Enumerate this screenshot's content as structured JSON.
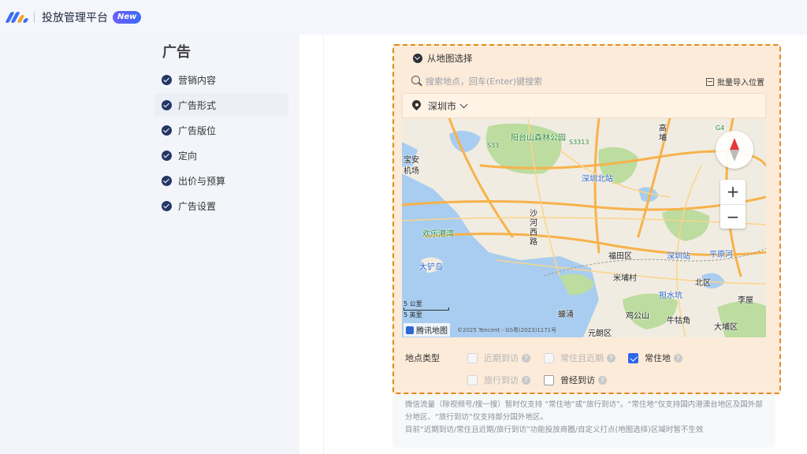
{
  "header": {
    "title": "投放管理平台",
    "badge": "New"
  },
  "sidebar": {
    "title": "广告",
    "steps": [
      {
        "label": "营销内容"
      },
      {
        "label": "广告形式"
      },
      {
        "label": "广告版位"
      },
      {
        "label": "定向"
      },
      {
        "label": "出价与预算"
      },
      {
        "label": "广告设置"
      }
    ]
  },
  "map_select": {
    "title": "从地图选择",
    "search_placeholder": "搜索地点，回车(Enter)键搜索",
    "batch_import": "批量导入位置",
    "city": "深圳市",
    "map": {
      "labels": [
        "阳台山森林公园",
        "深圳北站",
        "宝安",
        "机场",
        "欢乐港湾",
        "沙",
        "河",
        "西",
        "路",
        "大铲岛",
        "福田区",
        "深圳站",
        "平原河",
        "米埔村",
        "北区",
        "担水坑",
        "李屋",
        "鸡公山",
        "牛牯角",
        "大埔区",
        "元朗区",
        "蠔涌",
        "高",
        "埔",
        "G4",
        "S33",
        "S3313"
      ],
      "scale_km": "5 公里",
      "scale_mi": "5 英里",
      "brand": "腾讯地图",
      "copyright": "©2025 Tencent - GS粤(2023)1171号",
      "zoom_in": "+",
      "zoom_out": "−"
    },
    "location_type": {
      "label": "地点类型",
      "options": [
        {
          "label": "近期到访",
          "state": "disabled"
        },
        {
          "label": "常住且近期",
          "state": "disabled"
        },
        {
          "label": "常住地",
          "state": "checked"
        },
        {
          "label": "旅行到访",
          "state": "disabled"
        },
        {
          "label": "曾经到访",
          "state": "enabled"
        }
      ],
      "help": "?"
    }
  },
  "notes": {
    "line1": "微信流量（除视频号/搜一搜）暂时仅支持 “常住地”或“旅行到访”。“常住地”仅支持国内港澳台地区及国外部",
    "line2": "分地区、“旅行到访”仅支持部分国外地区。",
    "line3": "目前“近期到访/常住且近期/旅行到访”功能投放商圈/自定义打点(地图选择)区域时暂不生效"
  }
}
